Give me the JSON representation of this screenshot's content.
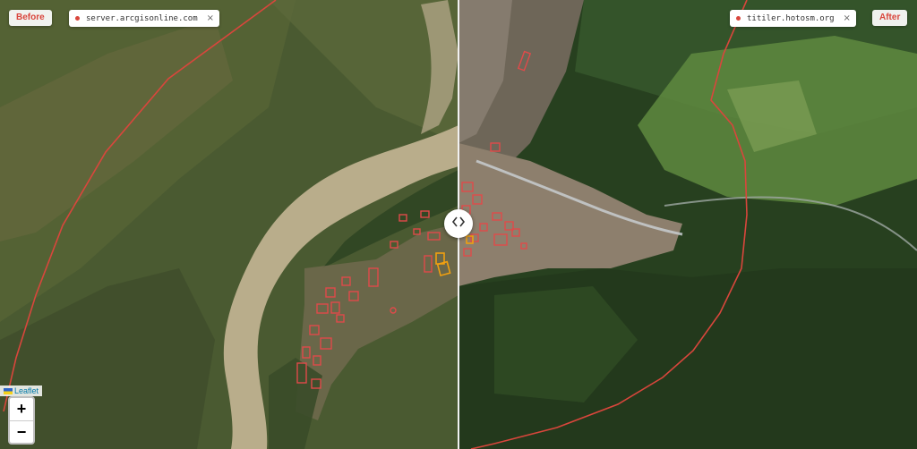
{
  "compare": {
    "before_label": "Before",
    "after_label": "After",
    "before_source": "server.arcgisonline.com",
    "after_source": "titiler.hotosm.org",
    "close_glyph": "×"
  },
  "controls": {
    "zoom_in": "+",
    "zoom_out": "−",
    "attribution": "Leaflet",
    "swipe_icon": "chevron-left-right-icon"
  },
  "colors": {
    "boundary_line": "#d9463c",
    "building_outline": "#e04a4a",
    "highlight_outline": "#f0a010",
    "tag_text": "#d9463c"
  }
}
